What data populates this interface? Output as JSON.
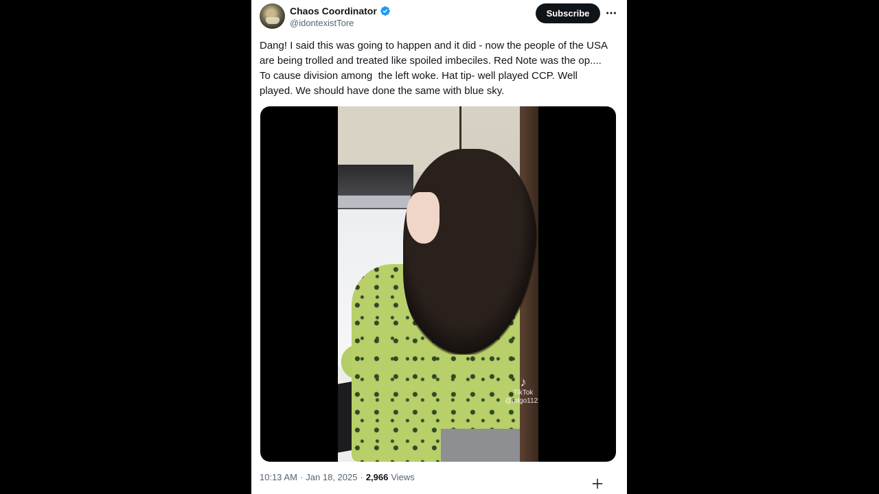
{
  "tweet": {
    "author": {
      "display_name": "Chaos Coordinator",
      "handle": "@idontexistTore",
      "verified": true
    },
    "subscribe_label": "Subscribe",
    "more_icon": "more-horizontal-icon",
    "text": "Dang! I said this was going to happen and it did - now the people of the USA are being trolled and treated like spoiled imbeciles. Red Note was the op.... To cause division among  the left woke. Hat tip- well played CCP. Well played. We should have done the same with blue sky.",
    "media": {
      "type": "video",
      "watermark_brand": "TikTok",
      "watermark_handle": "@mlgo1122"
    },
    "meta": {
      "time": "10:13 AM",
      "separator": "·",
      "date": "Jan 18, 2025",
      "views_count": "2,966",
      "views_label": "Views"
    }
  },
  "colors": {
    "background": "#000000",
    "card": "#ffffff",
    "text_primary": "#0f1419",
    "text_secondary": "#536471",
    "verified_blue": "#1d9bf0"
  }
}
